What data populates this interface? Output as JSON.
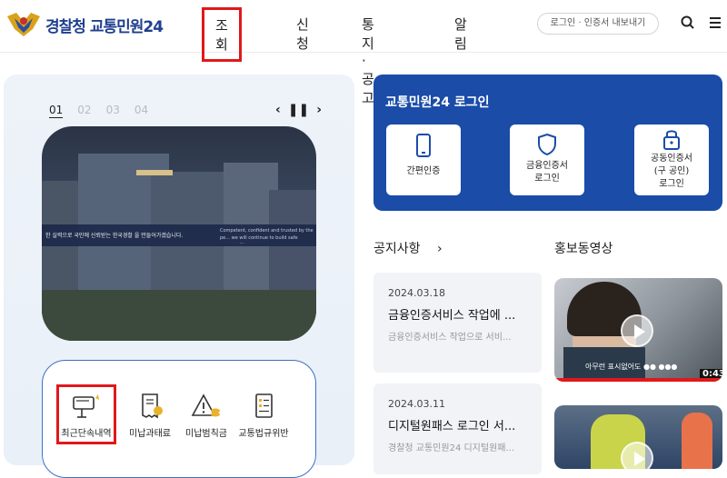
{
  "header": {
    "logo_text": "경찰청 교통민원24",
    "nav": [
      {
        "label": "조회",
        "active": true
      },
      {
        "label": "신청",
        "active": false
      },
      {
        "label": "통지·공고",
        "active": false
      },
      {
        "label": "알림",
        "active": false
      }
    ],
    "login_pill": "로그인 · 인증서 내보내기",
    "icons": [
      "search-icon",
      "menu-icon"
    ]
  },
  "slider": {
    "pages": [
      "01",
      "02",
      "03",
      "04"
    ],
    "active_page": "01",
    "banner_caption": "Competent, confident and trusted by the pe... we will continue to build safe communiti...",
    "banner_caption_kr": "한 실력으로 국민에 신뢰받는 한국경찰 을 만들어가겠습니다."
  },
  "quick_menu": [
    {
      "label": "최근단속내역",
      "icon": "camera-icon",
      "highlighted": true
    },
    {
      "label": "미납과태료",
      "icon": "receipt-icon",
      "highlighted": false
    },
    {
      "label": "미납범칙금",
      "icon": "warning-coins-icon",
      "highlighted": false
    },
    {
      "label": "교통법규위반",
      "icon": "checklist-icon",
      "highlighted": false
    }
  ],
  "login": {
    "title": "교통민원24 로그인",
    "options": [
      {
        "label": "간편인증",
        "icon": "phone-icon"
      },
      {
        "label": "금융인증서\n로그인",
        "icon": "shield-icon"
      },
      {
        "label": "공동인증서\n(구 공인)\n로그인",
        "icon": "lock-icon"
      }
    ]
  },
  "notices": {
    "title": "공지사항",
    "items": [
      {
        "date": "2024.03.18",
        "title": "금융인증서비스 작업에 ...",
        "summary": "금융인증서비스 작업으로 서비..."
      },
      {
        "date": "2024.03.11",
        "title": "디지털원패스 로그인 서...",
        "summary": "경찰청 교통민원24 디지털원패..."
      }
    ]
  },
  "videos": {
    "title": "홍보동영상",
    "items": [
      {
        "subtitle": "아무런 표시없어도 ●● ●●●",
        "duration": "0:43"
      },
      {
        "subtitle": "",
        "duration": ""
      }
    ]
  },
  "colors": {
    "brand_blue": "#1a4ca8",
    "highlight_red": "#e0181b",
    "logo_blue": "#1f3f8f"
  }
}
